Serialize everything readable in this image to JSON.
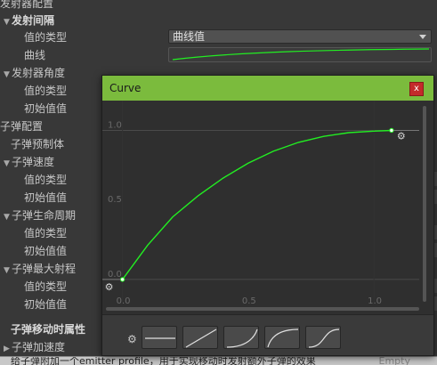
{
  "inspector": {
    "emitter_config_title": "发射器配置",
    "emit_interval": {
      "label": "发射间隔",
      "type_label": "值的类型",
      "type_value": "曲线值",
      "curve_label": "曲线"
    },
    "emitter_angle": {
      "label": "发射器角度",
      "type_label": "值的类型",
      "initial_label": "初始值值"
    },
    "bullet_config_title": "子弹配置",
    "bullet_prefab_label": "子弹预制体",
    "bullet_speed": {
      "label": "子弹速度",
      "type_label": "值的类型",
      "initial_label": "初始值值"
    },
    "bullet_lifetime": {
      "label": "子弹生命周期",
      "type_label": "值的类型",
      "initial_label": "初始值值"
    },
    "bullet_range": {
      "label": "子弹最大射程",
      "type_label": "值的类型",
      "initial_label": "初始值值"
    },
    "bullet_move_title": "子弹移动时属性",
    "bullet_accel_label": "子弹加速度"
  },
  "status_bar": {
    "text": "给子弹附加一个emitter profile，用于实现移动时发射额外子弹的效果",
    "right_text": "Empty"
  },
  "curve_window": {
    "title": "Curve",
    "close_label": "x",
    "y_ticks": [
      "0.0",
      "0.5",
      "1.0"
    ],
    "x_ticks": [
      "0.0",
      "0.5",
      "1.0"
    ],
    "colors": {
      "title_bar": "#7bbb3d",
      "curve": "#22ee22",
      "close": "#c42b2b"
    }
  },
  "chart_data": {
    "type": "line",
    "title": "Curve",
    "xlabel": "",
    "ylabel": "",
    "xlim": [
      -0.08,
      1.18
    ],
    "ylim": [
      -0.15,
      1.2
    ],
    "series": [
      {
        "x": [
          0.0,
          0.1,
          0.2,
          0.3,
          0.4,
          0.5,
          0.6,
          0.7,
          0.8,
          0.9,
          1.0,
          1.07
        ],
        "y": [
          0.0,
          0.23,
          0.42,
          0.56,
          0.68,
          0.78,
          0.86,
          0.92,
          0.96,
          0.985,
          0.995,
          1.0
        ]
      }
    ],
    "keyframes": [
      {
        "x": 0.0,
        "y": 0.0
      },
      {
        "x": 1.07,
        "y": 1.0
      }
    ],
    "grid": false
  }
}
